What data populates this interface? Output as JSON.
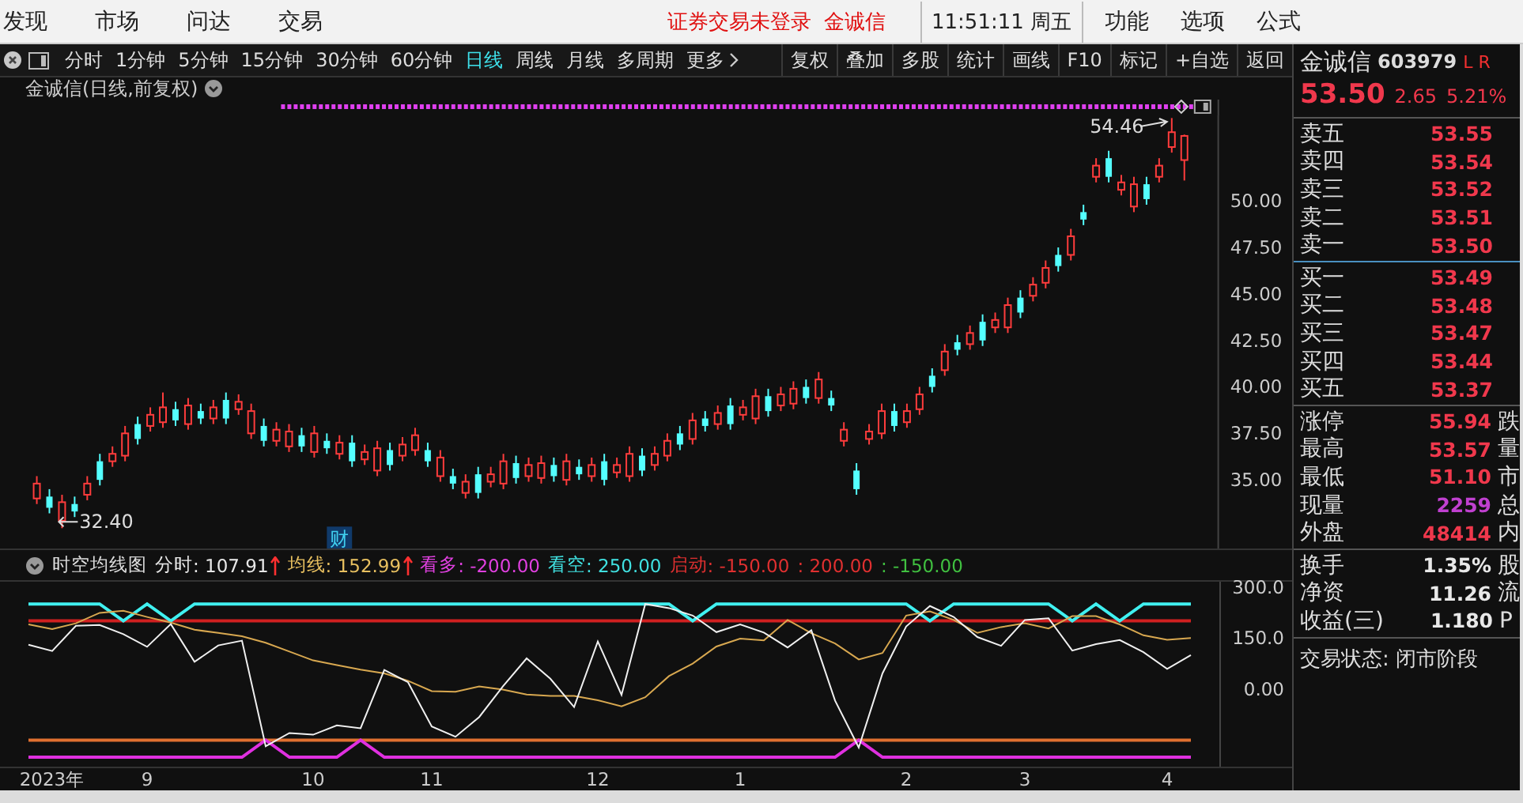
{
  "menu": [
    "发现",
    "市场",
    "问达",
    "交易"
  ],
  "login_notice": "证券交易未登录",
  "stock_link": "金诚信",
  "clock": "11:51:11 周五",
  "right_menu": [
    "功能",
    "选项",
    "公式"
  ],
  "period_tabs": [
    {
      "label": "分时",
      "selected": false
    },
    {
      "label": "1分钟",
      "selected": false
    },
    {
      "label": "5分钟",
      "selected": false
    },
    {
      "label": "15分钟",
      "selected": false
    },
    {
      "label": "30分钟",
      "selected": false
    },
    {
      "label": "60分钟",
      "selected": false
    },
    {
      "label": "日线",
      "selected": true
    },
    {
      "label": "周线",
      "selected": false
    },
    {
      "label": "月线",
      "selected": false
    },
    {
      "label": "多周期",
      "selected": false
    },
    {
      "label": "更多",
      "selected": false
    }
  ],
  "tools": [
    "复权",
    "叠加",
    "多股",
    "统计",
    "画线",
    "F10",
    "标记",
    "+自选",
    "返回"
  ],
  "chart": {
    "title": "金诚信(日线,前复权)",
    "high_label": "54.46",
    "low_label": "32.40",
    "event_marker": "财",
    "chart_data": {
      "type": "candlestick",
      "categories": [
        null,
        null,
        null,
        null,
        null,
        null,
        null,
        null,
        null,
        null,
        null,
        null,
        null,
        null,
        null,
        null,
        null,
        null,
        null,
        null,
        null,
        null,
        null,
        null,
        null,
        null,
        null,
        null,
        null,
        null,
        null,
        null,
        null,
        null,
        null,
        null,
        null,
        null,
        null,
        null,
        null,
        null,
        null,
        null,
        null,
        null,
        null,
        null,
        null,
        null,
        null,
        null,
        null,
        null,
        null,
        null,
        null,
        null,
        null,
        null,
        null,
        null,
        null,
        null,
        null,
        null,
        null,
        null,
        null,
        null,
        null,
        null,
        null,
        null,
        null,
        null,
        null,
        null,
        null,
        null,
        null,
        null,
        null,
        null,
        null,
        null,
        null,
        null,
        null,
        null,
        null,
        null
      ],
      "ylim": [
        31.3,
        55.45
      ],
      "yticks": [
        {
          "value": 50,
          "label": "50.00"
        },
        {
          "value": 47.5,
          "label": "47.50"
        },
        {
          "value": 45,
          "label": "45.00"
        },
        {
          "value": 42.5,
          "label": "42.50"
        },
        {
          "value": 40,
          "label": "40.00"
        },
        {
          "value": 37.5,
          "label": "37.50"
        },
        {
          "value": 35,
          "label": "35.00"
        }
      ],
      "ohlc": [
        [
          34.0,
          35.2,
          33.7,
          34.8
        ],
        [
          34.1,
          34.5,
          33.2,
          33.5
        ],
        [
          32.8,
          34.2,
          32.4,
          33.8
        ],
        [
          33.7,
          34.1,
          33.0,
          33.3
        ],
        [
          34.2,
          35.2,
          33.9,
          34.8
        ],
        [
          36.0,
          36.4,
          34.7,
          35.0
        ],
        [
          36.0,
          36.8,
          35.7,
          36.4
        ],
        [
          36.3,
          37.9,
          36.0,
          37.5
        ],
        [
          38.0,
          38.4,
          36.9,
          37.2
        ],
        [
          37.9,
          38.9,
          37.6,
          38.5
        ],
        [
          38.1,
          39.7,
          37.8,
          38.9
        ],
        [
          38.8,
          39.2,
          37.9,
          38.2
        ],
        [
          38.0,
          39.4,
          37.7,
          39.0
        ],
        [
          38.7,
          39.1,
          38.0,
          38.3
        ],
        [
          38.3,
          39.3,
          38.0,
          38.9
        ],
        [
          39.3,
          39.7,
          38.0,
          38.3
        ],
        [
          38.8,
          39.6,
          38.5,
          39.2
        ],
        [
          37.5,
          39.1,
          37.2,
          38.7
        ],
        [
          37.9,
          38.3,
          36.8,
          37.1
        ],
        [
          37.1,
          38.1,
          36.8,
          37.7
        ],
        [
          36.8,
          38.0,
          36.5,
          37.6
        ],
        [
          37.4,
          37.8,
          36.5,
          36.8
        ],
        [
          36.5,
          37.9,
          36.2,
          37.5
        ],
        [
          37.1,
          37.5,
          36.4,
          36.7
        ],
        [
          36.4,
          37.4,
          36.1,
          37.0
        ],
        [
          37.0,
          37.4,
          35.7,
          36.0
        ],
        [
          36.1,
          36.9,
          35.8,
          36.5
        ],
        [
          35.5,
          37.1,
          35.2,
          36.7
        ],
        [
          36.6,
          37.0,
          35.5,
          35.8
        ],
        [
          36.3,
          37.3,
          36.0,
          36.9
        ],
        [
          36.6,
          37.8,
          36.3,
          37.4
        ],
        [
          36.6,
          37.0,
          35.7,
          36.0
        ],
        [
          35.2,
          36.6,
          34.9,
          36.2
        ],
        [
          35.2,
          35.6,
          34.5,
          34.8
        ],
        [
          34.3,
          35.3,
          34.0,
          34.9
        ],
        [
          35.3,
          35.7,
          34.0,
          34.3
        ],
        [
          34.9,
          35.7,
          34.6,
          35.3
        ],
        [
          34.8,
          36.4,
          34.5,
          36.0
        ],
        [
          35.9,
          36.3,
          34.8,
          35.1
        ],
        [
          35.2,
          36.2,
          34.9,
          35.8
        ],
        [
          35.1,
          36.3,
          34.8,
          35.9
        ],
        [
          35.8,
          36.2,
          34.9,
          35.2
        ],
        [
          35.0,
          36.4,
          34.7,
          36.0
        ],
        [
          35.7,
          36.1,
          35.0,
          35.3
        ],
        [
          35.2,
          36.2,
          34.9,
          35.8
        ],
        [
          36.0,
          36.4,
          34.7,
          35.0
        ],
        [
          35.4,
          36.2,
          35.1,
          35.8
        ],
        [
          35.2,
          36.8,
          34.9,
          36.4
        ],
        [
          36.3,
          36.7,
          35.2,
          35.5
        ],
        [
          35.8,
          36.8,
          35.5,
          36.4
        ],
        [
          36.3,
          37.5,
          36.0,
          37.1
        ],
        [
          37.5,
          37.9,
          36.6,
          36.9
        ],
        [
          37.2,
          38.6,
          36.9,
          38.2
        ],
        [
          38.3,
          38.7,
          37.6,
          37.9
        ],
        [
          38.0,
          39.0,
          37.7,
          38.6
        ],
        [
          39.0,
          39.4,
          37.7,
          38.0
        ],
        [
          38.5,
          39.3,
          38.2,
          38.9
        ],
        [
          38.3,
          39.9,
          38.0,
          39.5
        ],
        [
          39.5,
          39.9,
          38.4,
          38.7
        ],
        [
          39.0,
          40.0,
          38.7,
          39.6
        ],
        [
          39.1,
          40.3,
          38.8,
          39.9
        ],
        [
          40.0,
          40.4,
          39.1,
          39.4
        ],
        [
          39.4,
          40.8,
          39.1,
          40.4
        ],
        [
          39.4,
          39.8,
          38.7,
          39.0
        ],
        [
          37.1,
          38.1,
          36.8,
          37.7
        ],
        [
          35.5,
          35.9,
          34.2,
          34.5
        ],
        [
          37.2,
          38.0,
          36.9,
          37.6
        ],
        [
          37.5,
          39.1,
          37.2,
          38.7
        ],
        [
          38.7,
          39.1,
          37.6,
          37.9
        ],
        [
          38.1,
          39.1,
          37.8,
          38.7
        ],
        [
          38.8,
          40.0,
          38.5,
          39.6
        ],
        [
          40.6,
          41.0,
          39.7,
          40.0
        ],
        [
          40.9,
          42.3,
          40.6,
          41.9
        ],
        [
          42.4,
          42.8,
          41.7,
          42.0
        ],
        [
          42.3,
          43.3,
          42.0,
          42.9
        ],
        [
          43.5,
          43.9,
          42.2,
          42.5
        ],
        [
          43.2,
          44.0,
          42.9,
          43.6
        ],
        [
          43.2,
          44.8,
          42.9,
          44.4
        ],
        [
          44.8,
          45.2,
          43.7,
          44.0
        ],
        [
          44.9,
          45.9,
          44.6,
          45.5
        ],
        [
          45.6,
          46.8,
          45.3,
          46.4
        ],
        [
          47.1,
          47.5,
          46.2,
          46.5
        ],
        [
          47.1,
          48.5,
          46.8,
          48.1
        ],
        [
          49.4,
          49.8,
          48.7,
          49.0
        ],
        [
          51.3,
          52.3,
          51.0,
          51.9
        ],
        [
          52.3,
          52.7,
          51.0,
          51.3
        ],
        [
          50.6,
          51.4,
          50.3,
          51.0
        ],
        [
          49.7,
          51.3,
          49.4,
          50.9
        ],
        [
          50.9,
          51.3,
          49.8,
          50.1
        ],
        [
          51.3,
          52.3,
          51.0,
          51.9
        ],
        [
          52.9,
          54.46,
          52.6,
          53.7
        ],
        [
          52.2,
          53.57,
          51.1,
          53.5
        ]
      ]
    }
  },
  "indicator": {
    "name": "时空均线图",
    "values": [
      {
        "reading": ": 107.91",
        "color": "#e8e8e8",
        "rising": true
      },
      {
        "reading": ": 152.99",
        "color": "#e8c060",
        "rising": true
      },
      {
        "reading": ": -200.00",
        "color": "#e040e0",
        "rising": false
      },
      {
        "reading": ": 250.00",
        "color": "#40e0e0",
        "rising": false
      },
      {
        "reading": ": -150.00",
        "color": "#e03030",
        "rising": false
      },
      {
        "reading": ": 200.00",
        "color": "#e03030",
        "rising": false
      },
      {
        "reading": ": -150.00",
        "color": "#40c040",
        "rising": false
      }
    ],
    "chart_data": {
      "type": "line",
      "categories": [
        null,
        "2023年",
        null,
        null,
        null,
        "9",
        null,
        null,
        null,
        null,
        null,
        null,
        "10",
        null,
        null,
        null,
        null,
        "11",
        null,
        null,
        null,
        null,
        null,
        null,
        "12",
        null,
        null,
        null,
        null,
        null,
        "1",
        null,
        null,
        null,
        null,
        null,
        null,
        "2",
        null,
        null,
        null,
        null,
        "3",
        null,
        null,
        null,
        null,
        null,
        "4",
        null
      ],
      "ylim": [
        -228,
        320
      ],
      "yticks": [
        {
          "value": 300,
          "label": "300.0"
        },
        {
          "value": 150,
          "label": "150.0"
        },
        {
          "value": 0,
          "label": "0.00"
        }
      ],
      "series": [
        {
          "name": "分时",
          "color": "#f0f0f0",
          "values": [
            130,
            112,
            186,
            188,
            161,
            124,
            191,
            80,
            128,
            142,
            -168,
            -129,
            -134,
            -107,
            -115,
            56,
            20,
            -110,
            -140,
            -82,
            8,
            90,
            30,
            -53,
            140,
            -17,
            250,
            238,
            216,
            167,
            190,
            166,
            122,
            173,
            -34,
            -172,
            46,
            184,
            244,
            212,
            153,
            127,
            203,
            208,
            113,
            132,
            144,
            108,
            59,
            100
          ]
        },
        {
          "name": "均线",
          "color": "#d8a850",
          "values": [
            190,
            176,
            193,
            224,
            230,
            212,
            195,
            174,
            165,
            155,
            136,
            110,
            84,
            70,
            57,
            46,
            24,
            -6,
            -8,
            8,
            -2,
            -16,
            -20,
            -20,
            -33,
            -51,
            -24,
            38,
            75,
            125,
            148,
            143,
            203,
            164,
            134,
            87,
            106,
            216,
            228,
            203,
            165,
            182,
            193,
            178,
            214,
            214,
            190,
            158,
            145,
            150
          ]
        },
        {
          "name": "看多",
          "color": "#e030e0",
          "values": [
            -200,
            -200,
            -200,
            -200,
            -200,
            -200,
            -200,
            -200,
            -200,
            -200,
            -150,
            -200,
            -200,
            -200,
            -150,
            -200,
            -200,
            -200,
            -200,
            -200,
            -200,
            -200,
            -200,
            -200,
            -200,
            -200,
            -200,
            -200,
            -200,
            -200,
            -200,
            -200,
            -200,
            -200,
            -200,
            -150,
            -200,
            -200,
            -200,
            -200,
            -200,
            -200,
            -200,
            -200,
            -200,
            -200,
            -200,
            -200,
            -200,
            -200
          ]
        },
        {
          "name": "看空",
          "color": "#40f0f0",
          "values": [
            250,
            250,
            250,
            250,
            200,
            250,
            200,
            250,
            250,
            250,
            250,
            250,
            250,
            250,
            250,
            250,
            250,
            250,
            250,
            250,
            250,
            250,
            250,
            250,
            250,
            250,
            250,
            250,
            200,
            250,
            250,
            250,
            250,
            250,
            250,
            250,
            250,
            250,
            200,
            250,
            250,
            250,
            250,
            250,
            200,
            250,
            200,
            250,
            250,
            250
          ]
        },
        {
          "name": "启动",
          "color": "#e07030",
          "values": [
            -150,
            -150,
            -150,
            -150,
            -150,
            -150,
            -150,
            -150,
            -150,
            -150,
            -150,
            -150,
            -150,
            -150,
            -150,
            -150,
            -150,
            -150,
            -150,
            -150,
            -150,
            -150,
            -150,
            -150,
            -150,
            -150,
            -150,
            -150,
            -150,
            -150,
            -150,
            -150,
            -150,
            -150,
            -150,
            -150,
            -150,
            -150,
            -150,
            -150,
            -150,
            -150,
            -150,
            -150,
            -150,
            -150,
            -150,
            -150,
            -150,
            -150
          ]
        },
        {
          "color": "#d02020",
          "values": [
            200,
            200,
            200,
            200,
            200,
            200,
            200,
            200,
            200,
            200,
            200,
            200,
            200,
            200,
            200,
            200,
            200,
            200,
            200,
            200,
            200,
            200,
            200,
            200,
            200,
            200,
            200,
            200,
            200,
            200,
            200,
            200,
            200,
            200,
            200,
            200,
            200,
            200,
            200,
            200,
            200,
            200,
            200,
            200,
            200,
            200,
            200,
            200,
            200,
            200
          ]
        }
      ]
    }
  },
  "quote": {
    "name": "金诚信",
    "code": "603979",
    "flags": "L R",
    "price": "53.50",
    "change": "2.65",
    "percent": "5.21%",
    "asks": [
      {
        "label": "卖五",
        "price": "53.55"
      },
      {
        "label": "卖四",
        "price": "53.54"
      },
      {
        "label": "卖三",
        "price": "53.52"
      },
      {
        "label": "卖二",
        "price": "53.51"
      },
      {
        "label": "卖一",
        "price": "53.50"
      }
    ],
    "bids": [
      {
        "label": "买一",
        "price": "53.49"
      },
      {
        "label": "买二",
        "price": "53.48"
      },
      {
        "label": "买三",
        "price": "53.47"
      },
      {
        "label": "买四",
        "price": "53.44"
      },
      {
        "label": "买五",
        "price": "53.37"
      }
    ],
    "stats": [
      {
        "label": "涨停",
        "value": "55.94",
        "extra": "跌",
        "color": "#f0384c"
      },
      {
        "label": "最高",
        "value": "53.57",
        "extra": "量",
        "color": "#f0384c"
      },
      {
        "label": "最低",
        "value": "51.10",
        "extra": "市",
        "color": "#f0384c"
      },
      {
        "label": "现量",
        "value": "2259",
        "extra": "总",
        "color": "#c040d0"
      },
      {
        "label": "外盘",
        "value": "48414",
        "extra": "内",
        "color": "#f0384c"
      }
    ],
    "fundamentals": [
      {
        "label": "换手",
        "value": "1.35%",
        "extra": "股"
      },
      {
        "label": "净资",
        "value": "11.26",
        "extra": "流"
      },
      {
        "label": "收益(三)",
        "value": "1.180",
        "extra": "P"
      }
    ],
    "status": "交易状态: 闭市阶段"
  }
}
